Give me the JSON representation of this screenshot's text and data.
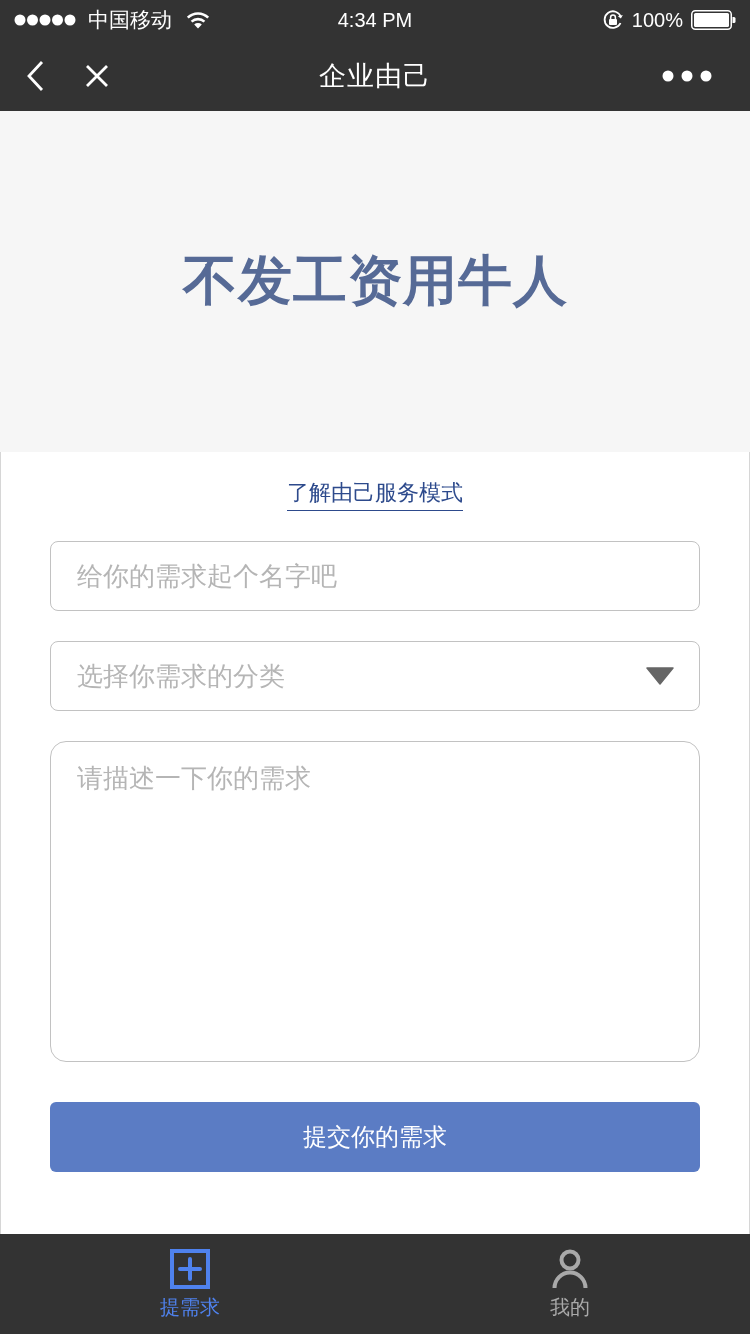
{
  "status_bar": {
    "carrier": "中国移动",
    "time": "4:34 PM",
    "battery": "100%"
  },
  "nav_bar": {
    "title": "企业由己"
  },
  "banner": {
    "headline": "不发工资用牛人"
  },
  "form": {
    "link": "了解由己服务模式",
    "name_field": {
      "placeholder": "给你的需求起个名字吧"
    },
    "category_select": {
      "placeholder": "选择你需求的分类"
    },
    "description_field": {
      "placeholder": "请描述一下你的需求"
    },
    "submit": "提交你的需求"
  },
  "tab_bar": [
    {
      "label": "提需求",
      "kind": "add",
      "selected": true
    },
    {
      "label": "我的",
      "kind": "profile",
      "selected": false
    }
  ]
}
